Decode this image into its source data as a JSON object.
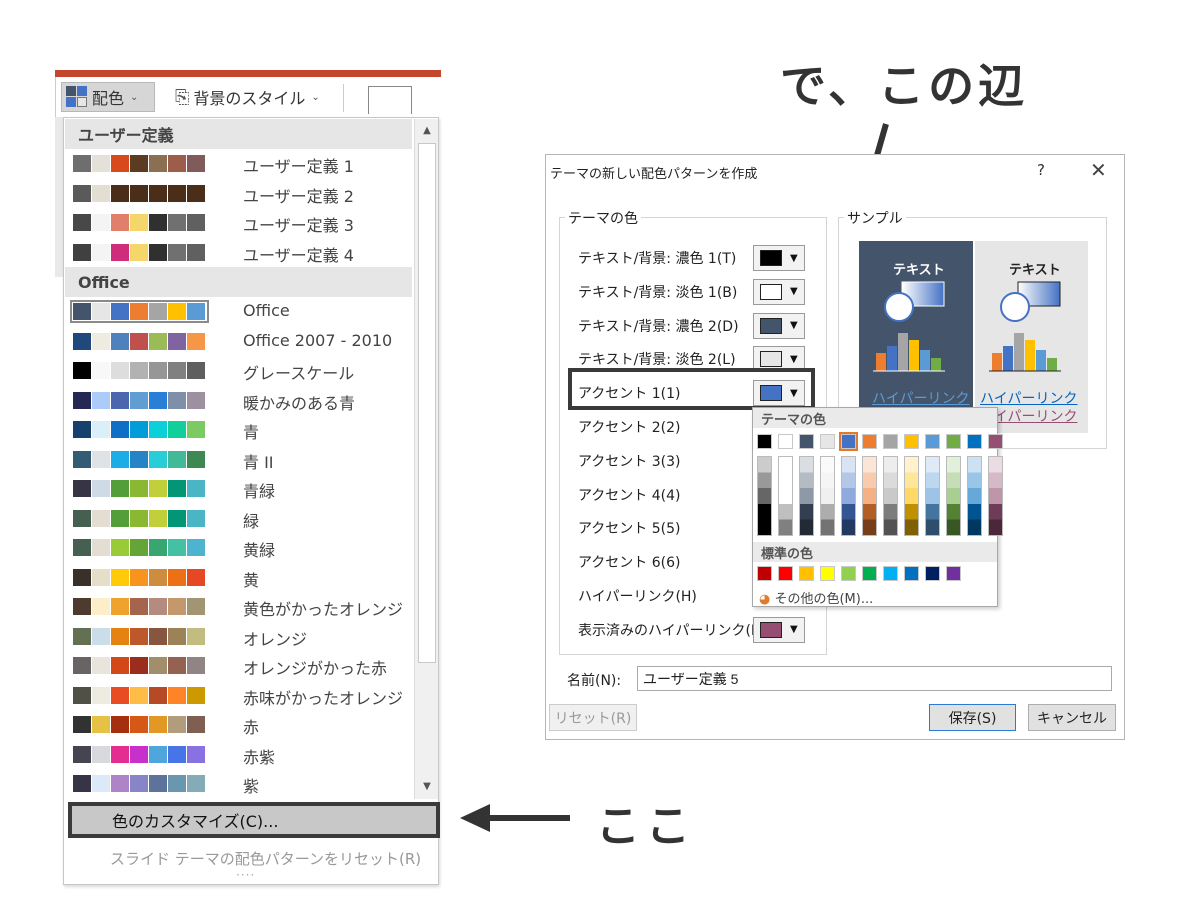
{
  "ribbon": {
    "color_button": "配色",
    "bg_style_button": "背景のスタイル"
  },
  "dropdown": {
    "sections": [
      {
        "title": "ユーザー定義",
        "items": [
          {
            "label": "ユーザー定義 1",
            "colors": [
              "#6e6e6e",
              "#e6e1d8",
              "#d84a1b",
              "#5b3b22",
              "#8a6f52",
              "#9e5d4a",
              "#7f5b5b"
            ]
          },
          {
            "label": "ユーザー定義 2",
            "colors": [
              "#5a5a5a",
              "#e3ddd2",
              "#4a2e1a",
              "#4a2e1a",
              "#4a2e1a",
              "#4a2e1a",
              "#4a2e1a"
            ]
          },
          {
            "label": "ユーザー定義 3",
            "colors": [
              "#484848",
              "#f4f4f4",
              "#e07f6a",
              "#f4d66a",
              "#303030",
              "#707070",
              "#606060"
            ]
          },
          {
            "label": "ユーザー定義 4",
            "colors": [
              "#404040",
              "#f4f4f4",
              "#d02c7c",
              "#f4d66a",
              "#303030",
              "#707070",
              "#606060"
            ]
          }
        ]
      },
      {
        "title": "Office",
        "items": [
          {
            "label": "Office",
            "colors": [
              "#44546a",
              "#e7e6e6",
              "#4472c4",
              "#ed7d31",
              "#a5a5a5",
              "#ffc000",
              "#5b9bd5"
            ],
            "selected": true
          },
          {
            "label": "Office 2007 - 2010",
            "colors": [
              "#1f497d",
              "#eeece1",
              "#4f81bd",
              "#c0504d",
              "#9bbb59",
              "#8064a2",
              "#f79646"
            ]
          },
          {
            "label": "グレースケール",
            "colors": [
              "#000000",
              "#f8f8f8",
              "#dddddd",
              "#b2b2b2",
              "#969696",
              "#808080",
              "#5f5f5f"
            ]
          },
          {
            "label": "暖かみのある青",
            "colors": [
              "#242852",
              "#accbf9",
              "#4a66ac",
              "#629dd1",
              "#297fd5",
              "#7f8fa9",
              "#9d90a0"
            ]
          },
          {
            "label": "青",
            "colors": [
              "#17406d",
              "#dbeff9",
              "#0f6fc6",
              "#009dd9",
              "#0bd0d9",
              "#10cf9b",
              "#7cca62"
            ]
          },
          {
            "label": "青 II",
            "colors": [
              "#335b74",
              "#dfe3e5",
              "#1cade4",
              "#2683c6",
              "#27ced7",
              "#42ba97",
              "#3e8853"
            ]
          },
          {
            "label": "青緑",
            "colors": [
              "#373545",
              "#cedbe6",
              "#549e39",
              "#8ab833",
              "#c0cf3a",
              "#029676",
              "#4ab5c4"
            ]
          },
          {
            "label": "緑",
            "colors": [
              "#455f51",
              "#e3ded1",
              "#549e39",
              "#8ab833",
              "#c0cf3a",
              "#029676",
              "#4ab5c4"
            ]
          },
          {
            "label": "黄緑",
            "colors": [
              "#455f51",
              "#e3ded1",
              "#99cb38",
              "#63a537",
              "#37a76f",
              "#44c1a3",
              "#4eb3cf"
            ]
          },
          {
            "label": "黄",
            "colors": [
              "#39302a",
              "#e5dec9",
              "#ffca08",
              "#f8931d",
              "#ce8d3e",
              "#ec7016",
              "#e64823"
            ]
          },
          {
            "label": "黄色がかったオレンジ",
            "colors": [
              "#4e3b30",
              "#fbeec9",
              "#f0a22e",
              "#a5644e",
              "#b58b80",
              "#c3986d",
              "#a19574"
            ]
          },
          {
            "label": "オレンジ",
            "colors": [
              "#637052",
              "#ccddea",
              "#e48312",
              "#bd582c",
              "#865640",
              "#9b8357",
              "#c2bc80"
            ]
          },
          {
            "label": "オレンジがかった赤",
            "colors": [
              "#696464",
              "#e9e5dc",
              "#d34817",
              "#9b2d1f",
              "#a28e6a",
              "#956251",
              "#918485"
            ]
          },
          {
            "label": "赤味がかったオレンジ",
            "colors": [
              "#505046",
              "#eeece1",
              "#e84c22",
              "#ffbd47",
              "#b64926",
              "#ff8427",
              "#cc9900"
            ]
          },
          {
            "label": "赤",
            "colors": [
              "#323232",
              "#e5c243",
              "#a5300f",
              "#d55816",
              "#e19825",
              "#b19c7d",
              "#7f5f52"
            ]
          },
          {
            "label": "赤紫",
            "colors": [
              "#454551",
              "#d8d9dc",
              "#e32d91",
              "#c830cc",
              "#4ea6dc",
              "#4775e7",
              "#8971e1"
            ]
          },
          {
            "label": "紫",
            "colors": [
              "#373545",
              "#dceaf7",
              "#ad84c6",
              "#8784c7",
              "#5d739a",
              "#6997af",
              "#84acb6"
            ]
          }
        ]
      }
    ],
    "customize": "色のカスタマイズ(C)...",
    "reset": "スライド テーマの配色パターンをリセット(R)",
    "grip": "····"
  },
  "callouts": {
    "here": "ここ",
    "around": "で、この辺"
  },
  "dialog": {
    "title": "テーマの新しい配色パターンを作成",
    "help": "?",
    "close": "✕",
    "theme_group": "テーマの色",
    "sample_group": "サンプル",
    "rows": [
      {
        "label": "テキスト/背景: 濃色 1(T)",
        "color": "#000000"
      },
      {
        "label": "テキスト/背景: 淡色 1(B)",
        "color": "#ffffff"
      },
      {
        "label": "テキスト/背景: 濃色 2(D)",
        "color": "#44546a"
      },
      {
        "label": "テキスト/背景: 淡色 2(L)",
        "color": "#e7e6e6"
      },
      {
        "label": "アクセント 1(1)",
        "color": "#4472c4"
      },
      {
        "label": "アクセント 2(2)",
        "color": ""
      },
      {
        "label": "アクセント 3(3)",
        "color": ""
      },
      {
        "label": "アクセント 4(4)",
        "color": ""
      },
      {
        "label": "アクセント 5(5)",
        "color": ""
      },
      {
        "label": "アクセント 6(6)",
        "color": ""
      },
      {
        "label": "ハイパーリンク(H)",
        "color": ""
      },
      {
        "label": "表示済みのハイパーリンク(E)",
        "color": "#954f72"
      }
    ],
    "sample": {
      "text": "テキスト",
      "hyperlink": "ハイパーリンク",
      "visited": "ハイパーリンク"
    },
    "popup": {
      "theme_heading": "テーマの色",
      "theme_colors": [
        "#000000",
        "#ffffff",
        "#44546a",
        "#e7e6e6",
        "#4472c4",
        "#ed7d31",
        "#a5a5a5",
        "#ffc000",
        "#5b9bd5",
        "#70ad47",
        "#0070c0",
        "#954f72"
      ],
      "standard_heading": "標準の色",
      "standard_colors": [
        "#c00000",
        "#ff0000",
        "#ffc000",
        "#ffff00",
        "#92d050",
        "#00b050",
        "#00b0f0",
        "#0070c0",
        "#002060",
        "#7030a0"
      ],
      "more": "その他の色(M)..."
    },
    "name_label": "名前(N):",
    "name_value": "ユーザー定義 5",
    "reset_btn": "リセット(R)",
    "save_btn": "保存(S)",
    "cancel_btn": "キャンセル"
  }
}
